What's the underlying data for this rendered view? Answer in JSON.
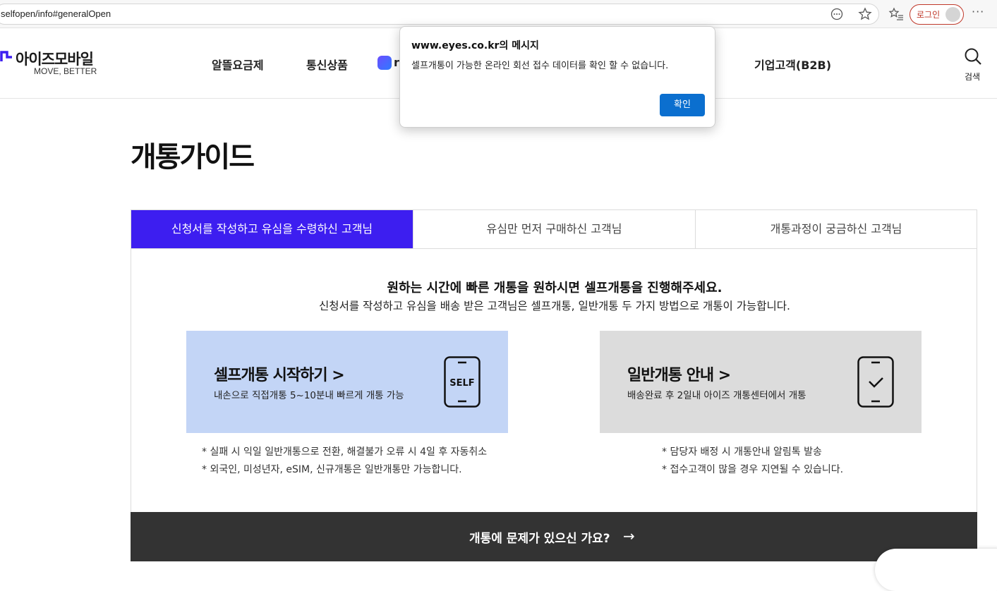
{
  "browser": {
    "url": "selfopen/info#generalOpen",
    "login_label": "로그인"
  },
  "header": {
    "logo_text": "아이즈모바일",
    "logo_tagline": "MOVE, BETTER",
    "nav": [
      {
        "label": "알뜰요금제"
      },
      {
        "label": "통신상품"
      },
      {
        "label": "r"
      },
      {
        "label": "기업고객(B2B)"
      }
    ],
    "search_label": "검색",
    "brand_color": "#3d1ef0"
  },
  "page": {
    "title": "개통가이드",
    "tabs": [
      {
        "label": "신청서를 작성하고 유심을 수령하신 고객님",
        "active": true
      },
      {
        "label": "유심만 먼저 구매하신 고객님",
        "active": false
      },
      {
        "label": "개통과정이 궁금하신 고객님",
        "active": false
      }
    ],
    "headline": "원하는 시간에 빠른 개통을 원하시면 셀프개통을 진행해주세요.",
    "subline": "신청서를 작성하고 유심을 배송 받은 고객님은 셀프개통, 일반개통 두 가지 방법으로 개통이 가능합니다.",
    "cards": {
      "self": {
        "title": "셀프개통 시작하기 >",
        "desc": "내손으로 직접개통 5~10분내 빠르게 개통 가능",
        "phone_text": "SELF",
        "notes": [
          "* 실패 시 익일 일반개통으로 전환, 해결불가 오류 시 4일 후 자동취소",
          "* 외국인, 미성년자, eSIM, 신규개통은 일반개통만 가능합니다."
        ]
      },
      "general": {
        "title": "일반개통 안내 >",
        "desc": "배송완료 후 2일내 아이즈 개통센터에서 개통",
        "notes": [
          "* 담당자 배정 시 개통안내 알림톡 발송",
          "* 접수고객이 많을 경우 지연될 수 있습니다."
        ]
      }
    },
    "bottom_bar": {
      "text": "개통에 문제가 있으신 가요?",
      "arrow": "→"
    }
  },
  "dialog": {
    "title": "www.eyes.co.kr의 메시지",
    "message": "셀프개통이 가능한 온라인 회선 접수 데이터를 확인 할 수 없습니다.",
    "ok_label": "확인"
  }
}
